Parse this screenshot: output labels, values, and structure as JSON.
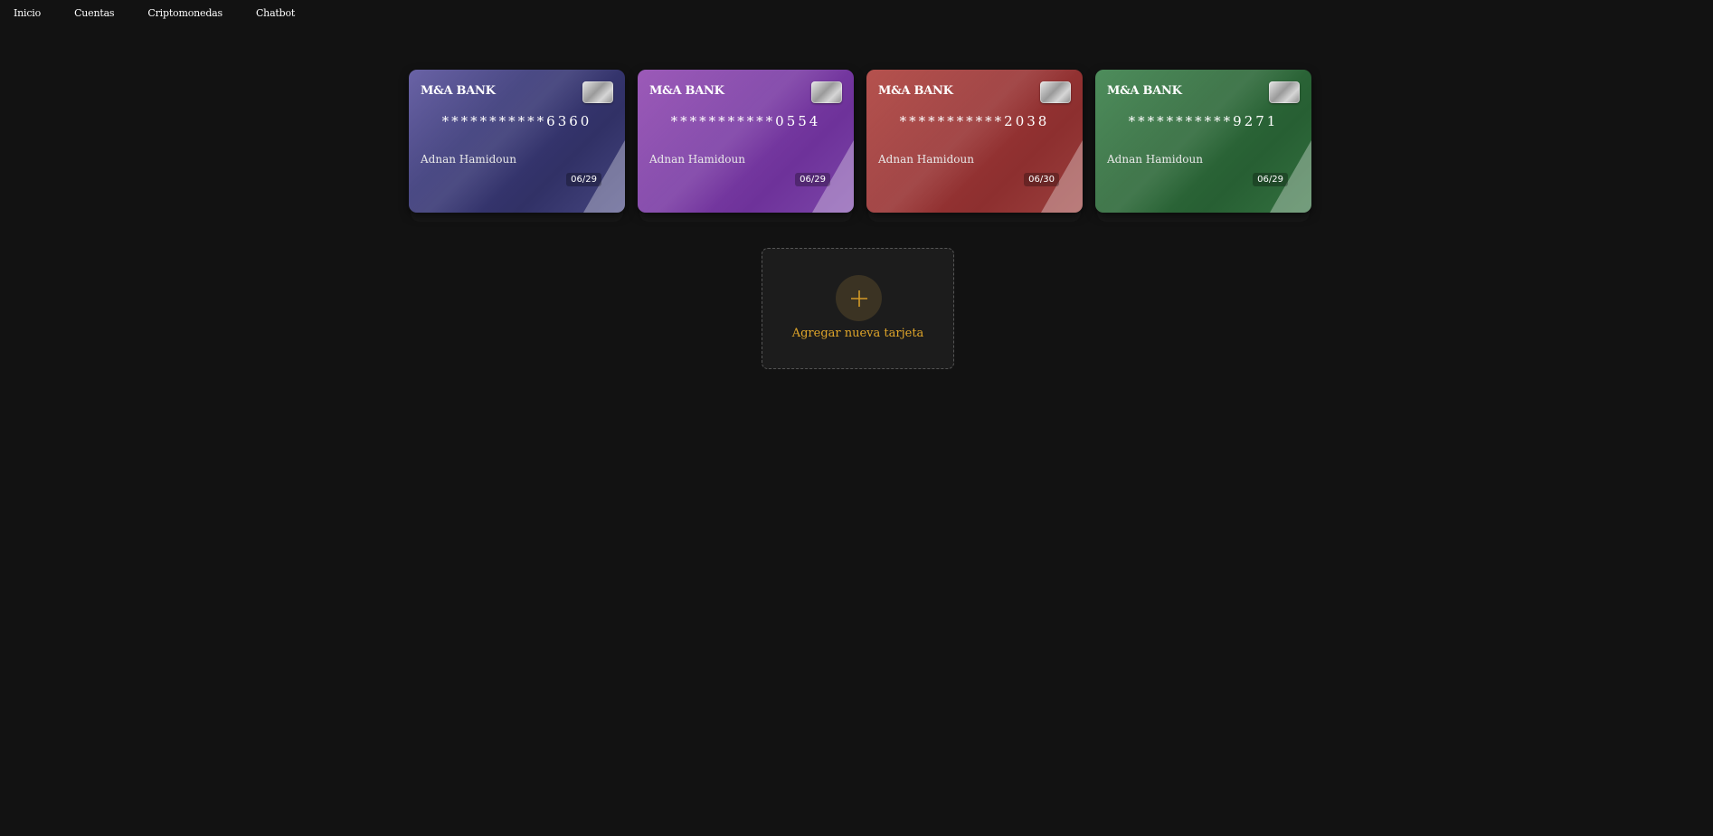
{
  "nav": {
    "items": [
      {
        "label": "Inicio"
      },
      {
        "label": "Cuentas"
      },
      {
        "label": "Criptomonedas"
      },
      {
        "label": "Chatbot"
      }
    ]
  },
  "cards": [
    {
      "bank": "M&A BANK",
      "number": "***********6360",
      "holder": "Adnan Hamidoun",
      "expiry": "06/29",
      "color": "#3b3a7a",
      "chip_icon": "card-chip-icon"
    },
    {
      "bank": "M&A BANK",
      "number": "***********0554",
      "holder": "Adnan Hamidoun",
      "expiry": "06/29",
      "color": "#7d3ea6",
      "chip_icon": "card-chip-icon"
    },
    {
      "bank": "M&A BANK",
      "number": "***********2038",
      "holder": "Adnan Hamidoun",
      "expiry": "06/30",
      "color": "#9b3636",
      "chip_icon": "card-chip-icon"
    },
    {
      "bank": "M&A BANK",
      "number": "***********9271",
      "holder": "Adnan Hamidoun",
      "expiry": "06/29",
      "color": "#2f6b3b",
      "chip_icon": "card-chip-icon"
    }
  ],
  "add_card": {
    "label": "Agregar nueva tarjeta",
    "icon": "plus-icon",
    "accent": "#e0a62a"
  }
}
